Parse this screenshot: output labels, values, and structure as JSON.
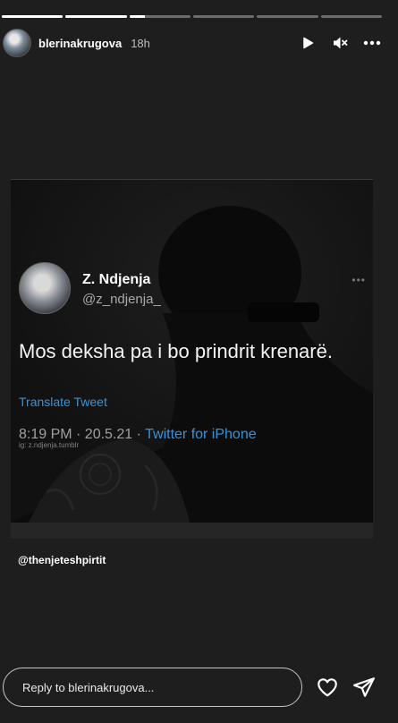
{
  "story": {
    "segments": [
      1,
      1,
      0.25,
      0,
      0,
      0
    ],
    "username": "blerinakrugova",
    "time": "18h",
    "icons": {
      "play": "play-icon",
      "mute": "speaker-muted-icon",
      "more": "more-horizontal-icon"
    }
  },
  "tweet": {
    "name": "Z. Ndjenja",
    "handle": "@z_ndjenja_",
    "more": "•••",
    "text": "Mos deksha pa i bo prindrit krenarë.",
    "translate": "Translate Tweet",
    "time": "8:19 PM · 20.5.21 · ",
    "source": "Twitter for iPhone",
    "watermark": "ig: z.ndjenja.tumblr"
  },
  "mention": "@thenjeteshpirtit",
  "reply": {
    "placeholder": "Reply to blerinakrugova..."
  },
  "colors": {
    "background": "#1e1e1e",
    "link": "#3a93d6"
  }
}
